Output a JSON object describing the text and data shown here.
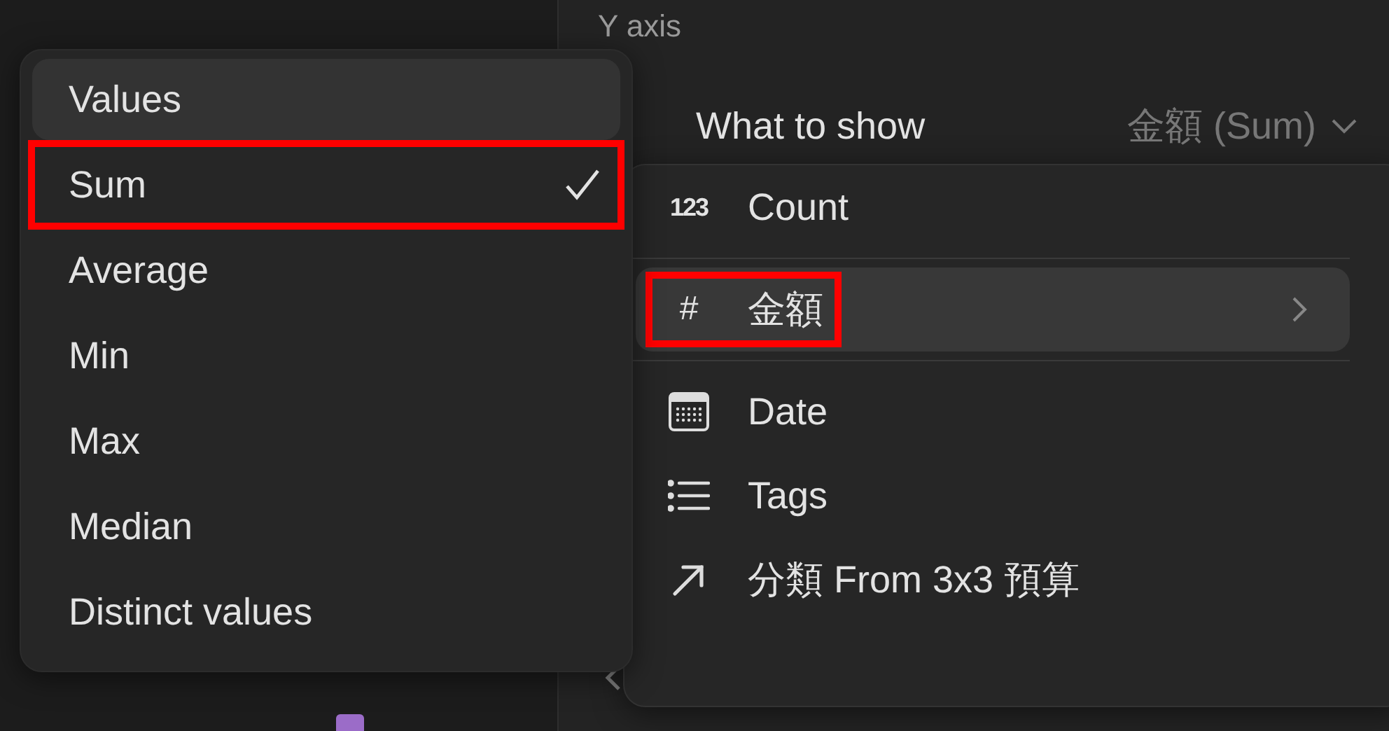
{
  "background": {
    "section_label": "Y axis",
    "setting": {
      "label": "What to show",
      "value": "金額 (Sum)"
    },
    "legend_row": {
      "color": "#9b6cc8"
    }
  },
  "aggregation_menu": {
    "items": [
      {
        "label": "Values",
        "selected": false,
        "hovered": true,
        "highlighted": false
      },
      {
        "label": "Sum",
        "selected": true,
        "hovered": false,
        "highlighted": true
      },
      {
        "label": "Average",
        "selected": false,
        "hovered": false,
        "highlighted": false
      },
      {
        "label": "Min",
        "selected": false,
        "hovered": false,
        "highlighted": false
      },
      {
        "label": "Max",
        "selected": false,
        "hovered": false,
        "highlighted": false
      },
      {
        "label": "Median",
        "selected": false,
        "hovered": false,
        "highlighted": false
      },
      {
        "label": "Distinct values",
        "selected": false,
        "hovered": false,
        "highlighted": false
      }
    ]
  },
  "property_menu": {
    "items": [
      {
        "kind": "count",
        "icon_text": "123",
        "label": "Count",
        "hovered": false,
        "highlighted": false,
        "submenu": false
      },
      {
        "kind": "number",
        "icon_text": "#",
        "label": "金額",
        "hovered": true,
        "highlighted": true,
        "submenu": true
      },
      {
        "kind": "date",
        "label": "Date",
        "hovered": false,
        "highlighted": false,
        "submenu": false
      },
      {
        "kind": "tags",
        "label": "Tags",
        "hovered": false,
        "highlighted": false,
        "submenu": false
      },
      {
        "kind": "relation",
        "label": "分類 From 3x3 預算",
        "hovered": false,
        "highlighted": false,
        "submenu": false
      }
    ]
  }
}
